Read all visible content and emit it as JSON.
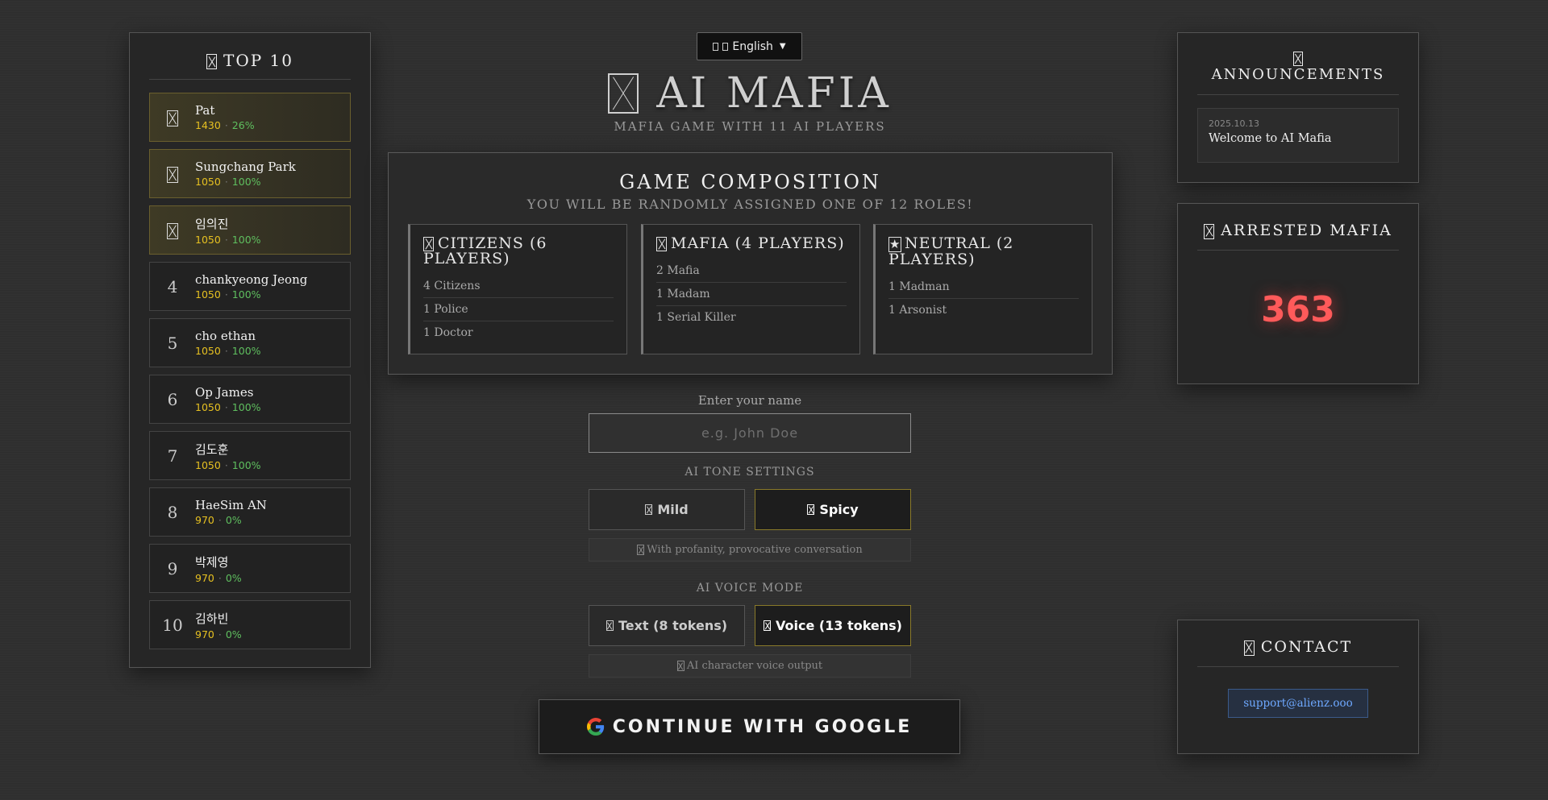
{
  "language": {
    "selected": "English"
  },
  "app": {
    "title": "AI MAFIA",
    "subtitle": "MAFIA GAME WITH 11 AI PLAYERS"
  },
  "leaderboard": {
    "title": "TOP 10",
    "rows": [
      {
        "rank": "1",
        "name": "Pat",
        "score": "1430",
        "rate": "26%"
      },
      {
        "rank": "2",
        "name": "Sungchang Park",
        "score": "1050",
        "rate": "100%"
      },
      {
        "rank": "3",
        "name": "임의진",
        "score": "1050",
        "rate": "100%"
      },
      {
        "rank": "4",
        "name": "chankyeong Jeong",
        "score": "1050",
        "rate": "100%"
      },
      {
        "rank": "5",
        "name": "cho ethan",
        "score": "1050",
        "rate": "100%"
      },
      {
        "rank": "6",
        "name": "Op James",
        "score": "1050",
        "rate": "100%"
      },
      {
        "rank": "7",
        "name": "김도훈",
        "score": "1050",
        "rate": "100%"
      },
      {
        "rank": "8",
        "name": "HaeSim AN",
        "score": "970",
        "rate": "0%"
      },
      {
        "rank": "9",
        "name": "박제영",
        "score": "970",
        "rate": "0%"
      },
      {
        "rank": "10",
        "name": "김하빈",
        "score": "970",
        "rate": "0%"
      }
    ],
    "separator": "·"
  },
  "composition": {
    "title": "GAME COMPOSITION",
    "subtitle": "YOU WILL BE RANDOMLY ASSIGNED ONE OF 12 ROLES!",
    "groups": [
      {
        "title": "CITIZENS (6 PLAYERS)",
        "icon": "citizen-icon",
        "items": [
          "4 Citizens",
          "1 Police",
          "1 Doctor"
        ]
      },
      {
        "title": "MAFIA (4 PLAYERS)",
        "icon": "mafia-icon",
        "items": [
          "2 Mafia",
          "1 Madam",
          "1 Serial Killer"
        ]
      },
      {
        "title": "NEUTRAL (2 PLAYERS)",
        "icon": "star-icon",
        "items": [
          "1 Madman",
          "1 Arsonist"
        ]
      }
    ]
  },
  "name_field": {
    "label": "Enter your name",
    "placeholder": "e.g. John Doe",
    "value": ""
  },
  "tone": {
    "label": "AI TONE SETTINGS",
    "options": [
      {
        "label": "Mild",
        "active": false
      },
      {
        "label": "Spicy",
        "active": true
      }
    ],
    "hint": "With profanity, provocative conversation"
  },
  "voice": {
    "label": "AI VOICE MODE",
    "options": [
      {
        "label": "Text (8 tokens)",
        "active": false
      },
      {
        "label": "Voice (13 tokens)",
        "active": true
      }
    ],
    "hint": "AI character voice output"
  },
  "google_button": {
    "label": "CONTINUE WITH GOOGLE"
  },
  "announcements": {
    "title": "ANNOUNCEMENTS",
    "items": [
      {
        "date": "2025.10.13",
        "text": "Welcome to AI Mafia"
      }
    ]
  },
  "arrested": {
    "title": "ARRESTED MAFIA",
    "count": "363"
  },
  "contact": {
    "title": "CONTACT",
    "email": "support@alienz.ooo"
  },
  "colors": {
    "score": "#e6c021",
    "rate": "#5fbf5f",
    "arrested": "#ff5a5a",
    "link": "#6ea8ff",
    "active_border": "#8a7a2a"
  }
}
